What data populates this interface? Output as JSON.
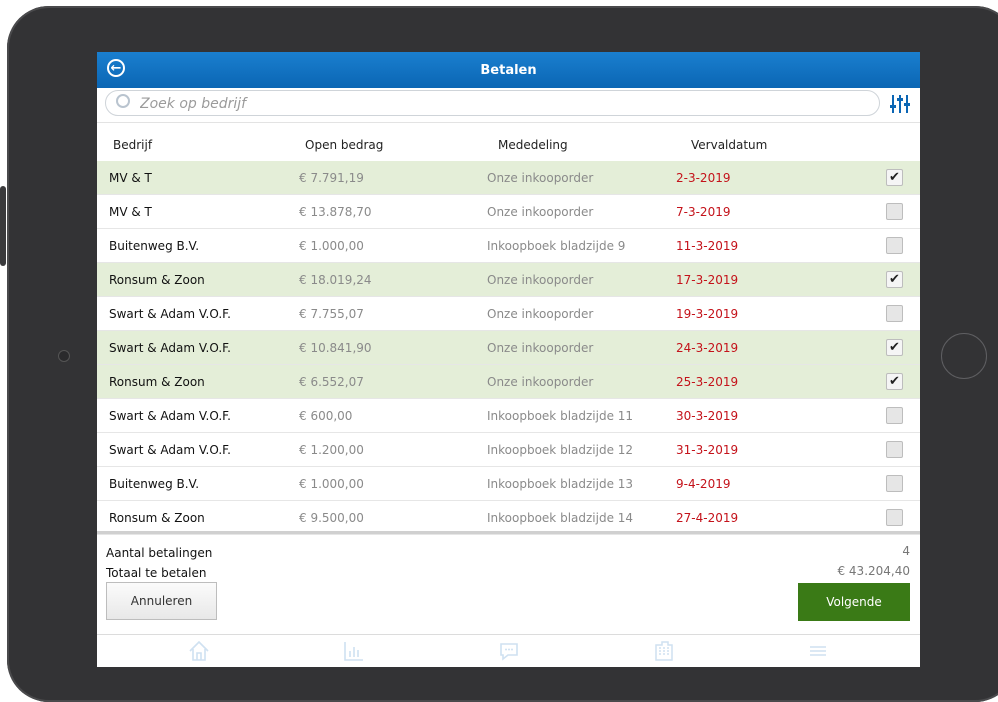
{
  "app": {
    "title": "Betalen"
  },
  "search": {
    "placeholder": "Zoek op bedrijf"
  },
  "columns": {
    "company": "Bedrijf",
    "amount": "Open bedrag",
    "message": "Mededeling",
    "due_date": "Vervaldatum"
  },
  "rows": [
    {
      "company": "MV & T",
      "amount": "€ 7.791,19",
      "message": "Onze inkooporder",
      "due_date": "2-3-2019",
      "selected": true,
      "check": "✔"
    },
    {
      "company": "MV & T",
      "amount": "€ 13.878,70",
      "message": "Onze inkooporder",
      "due_date": "7-3-2019",
      "selected": false,
      "check": ""
    },
    {
      "company": "Buitenweg B.V.",
      "amount": "€ 1.000,00",
      "message": "Inkoopboek bladzijde 9",
      "due_date": "11-3-2019",
      "selected": false,
      "check": ""
    },
    {
      "company": "Ronsum & Zoon",
      "amount": "€ 18.019,24",
      "message": "Onze inkooporder",
      "due_date": "17-3-2019",
      "selected": true,
      "check": "✔"
    },
    {
      "company": "Swart & Adam V.O.F.",
      "amount": "€ 7.755,07",
      "message": "Onze inkooporder",
      "due_date": "19-3-2019",
      "selected": false,
      "check": ""
    },
    {
      "company": "Swart & Adam V.O.F.",
      "amount": "€ 10.841,90",
      "message": "Onze inkooporder",
      "due_date": "24-3-2019",
      "selected": true,
      "check": "✔"
    },
    {
      "company": "Ronsum & Zoon",
      "amount": "€ 6.552,07",
      "message": "Onze inkooporder",
      "due_date": "25-3-2019",
      "selected": true,
      "check": "✔"
    },
    {
      "company": "Swart & Adam V.O.F.",
      "amount": "€ 600,00",
      "message": "Inkoopboek bladzijde 11",
      "due_date": "30-3-2019",
      "selected": false,
      "check": ""
    },
    {
      "company": "Swart & Adam V.O.F.",
      "amount": "€ 1.200,00",
      "message": "Inkoopboek bladzijde 12",
      "due_date": "31-3-2019",
      "selected": false,
      "check": ""
    },
    {
      "company": "Buitenweg B.V.",
      "amount": "€ 1.000,00",
      "message": "Inkoopboek bladzijde 13",
      "due_date": "9-4-2019",
      "selected": false,
      "check": ""
    },
    {
      "company": "Ronsum & Zoon",
      "amount": "€ 9.500,00",
      "message": "Inkoopboek bladzijde 14",
      "due_date": "27-4-2019",
      "selected": false,
      "check": ""
    }
  ],
  "summary": {
    "count_label": "Aantal betalingen",
    "count_value": "4",
    "total_label": "Totaal te betalen",
    "total_value": "€ 43.204,40"
  },
  "buttons": {
    "cancel": "Annuleren",
    "next": "Volgende"
  },
  "tabs": [
    {
      "icon": "home-icon"
    },
    {
      "icon": "chart-icon"
    },
    {
      "icon": "chat-icon"
    },
    {
      "icon": "building-icon"
    },
    {
      "icon": "menu-icon"
    }
  ],
  "colors": {
    "header_blue": "#0b66b4",
    "selected_row": "#e4eed8",
    "due_date_red": "#c4121a",
    "next_button_green": "#3a7a16",
    "tab_icon": "#cfe1f1"
  }
}
